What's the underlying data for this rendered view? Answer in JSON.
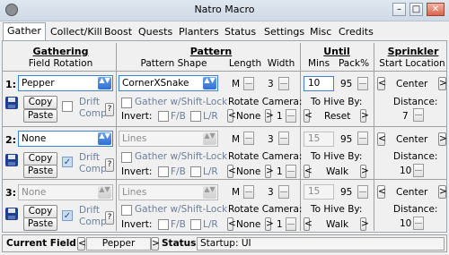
{
  "window": {
    "title": "Natro Macro",
    "min_glyph": "–",
    "max_glyph": "□",
    "close_glyph": "✕"
  },
  "tabs": [
    "Gather",
    "Collect/Kill",
    "Boost",
    "Quests",
    "Planters",
    "Status",
    "Settings",
    "Misc",
    "Credits"
  ],
  "active_tab": "Gather",
  "headers": {
    "gathering": "Gathering",
    "field_rotation": "Field Rotation",
    "pattern": "Pattern",
    "pattern_shape": "Pattern Shape",
    "length": "Length",
    "width": "Width",
    "until": "Until",
    "mins": "Mins",
    "pack": "Pack%",
    "sprinkler": "Sprinkler",
    "start_location": "Start Location"
  },
  "labels": {
    "copy": "Copy",
    "paste": "Paste",
    "drift": "Drift",
    "comp": "Comp",
    "help": "?",
    "gather_shift": "Gather w/Shift-Lock",
    "invert": "Invert:",
    "fb": "F/B",
    "lr": "L/R",
    "rotate_camera": "Rotate Camera:",
    "to_hive_by": "To Hive By:",
    "distance": "Distance:",
    "m": "M",
    "left_arrow": "<",
    "right_arrow": ">",
    "combo_arrow": "▲▼"
  },
  "rows": [
    {
      "num": "1:",
      "field": "Pepper",
      "drift_checked": false,
      "shape": "CornerXSnake",
      "length": "3",
      "rot_dir": "None",
      "rot_n": "1",
      "mins": "10",
      "pack": "95",
      "return": "Reset",
      "sprinkler": "Center",
      "distance": "7",
      "disabled": false
    },
    {
      "num": "2:",
      "field": "None",
      "drift_checked": true,
      "shape": "Lines",
      "length": "3",
      "rot_dir": "None",
      "rot_n": "1",
      "mins": "15",
      "pack": "95",
      "return": "Walk",
      "sprinkler": "Center",
      "distance": "10",
      "disabled": true
    },
    {
      "num": "3:",
      "field": "None",
      "drift_checked": true,
      "shape": "Lines",
      "length": "3",
      "rot_dir": "None",
      "rot_n": "1",
      "mins": "15",
      "pack": "95",
      "return": "Walk",
      "sprinkler": "Center",
      "distance": "10",
      "disabled": true
    }
  ],
  "statusbar": {
    "current_field_label": "Current Field:",
    "current_field": "Pepper",
    "status_label": "Status:",
    "status": "Startup: UI"
  }
}
